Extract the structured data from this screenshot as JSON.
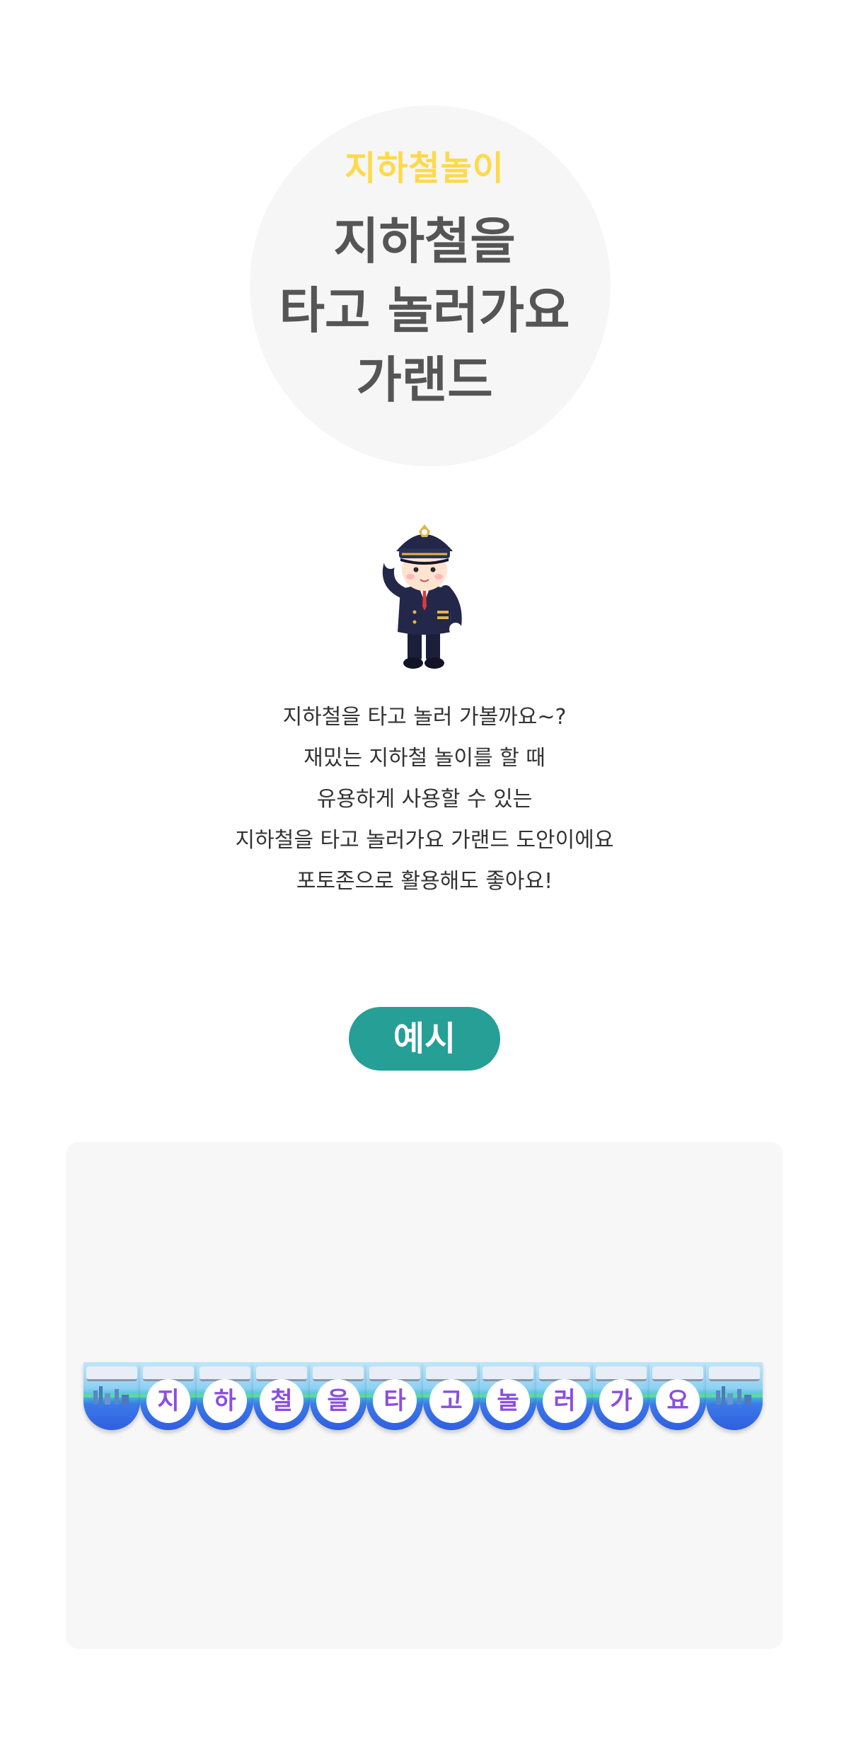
{
  "header": {
    "subtitle": "지하철놀이",
    "title_lines": [
      "지하철을",
      "타고 놀러가요",
      "가랜드"
    ]
  },
  "description": {
    "lines": [
      "지하철을 타고 놀러 가볼까요~?",
      "재밌는 지하철 놀이를 할 때",
      "유용하게 사용할 수 있는",
      "지하철을 타고 놀러가요 가랜드 도안이에요",
      "포토존으로 활용해도 좋아요!"
    ]
  },
  "example": {
    "button_label": "예시",
    "garland_letters": [
      "지",
      "하",
      "철",
      "을",
      "타",
      "고",
      "놀",
      "러",
      "가",
      "요"
    ]
  },
  "colors": {
    "subtitle": "#ffd94a",
    "title": "#555555",
    "button": "#269f96",
    "letter": "#8a4fe0"
  },
  "icons": {
    "illustration": "train-conductor-saluting"
  }
}
